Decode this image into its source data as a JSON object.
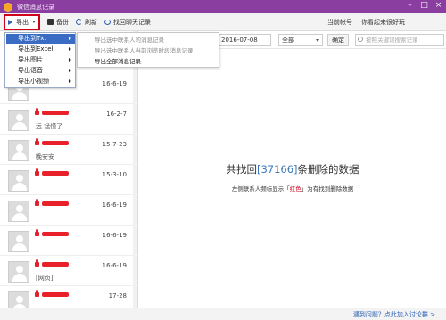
{
  "window": {
    "title": "微信消息记录"
  },
  "toolbar": {
    "export_label": "导出",
    "backup_label": "备份",
    "refresh_label": "刷新",
    "find_label": "找回聊天记录",
    "current_account_label": "当前帐号",
    "greeting": "你看起来很好玩"
  },
  "filters": {
    "date": "2016-07-08",
    "scope": "全部",
    "confirm_label": "确定",
    "search_placeholder": "按照关键词搜索记录"
  },
  "export_menu": {
    "items": [
      {
        "label": "导出到Txt"
      },
      {
        "label": "导出到Excel"
      },
      {
        "label": "导出图片"
      },
      {
        "label": "导出语音"
      },
      {
        "label": "导出小视频"
      }
    ]
  },
  "export_submenu": {
    "items": [
      {
        "label": "导出选中联系人的消息记录"
      },
      {
        "label": "导出选中联系人当前浏览时段消息记录"
      },
      {
        "label": "导出全部消息记录"
      }
    ]
  },
  "chats": [
    {
      "date": "16-6-19",
      "preview": ""
    },
    {
      "date": "16-2-7",
      "preview": "远 锰懂了"
    },
    {
      "date": "15-7-23",
      "preview": "晚安安"
    },
    {
      "date": "15-3-10",
      "preview": ""
    },
    {
      "date": "16-6-19",
      "preview": ""
    },
    {
      "date": "16-6-19",
      "preview": ""
    },
    {
      "date": "16-6-19",
      "preview": "[网页]"
    },
    {
      "date": "17-28",
      "preview": ""
    }
  ],
  "main": {
    "result_prefix": "共找回",
    "deleted_count": "[37166]",
    "result_suffix": "条删除的数据",
    "hint_prefix": "左侧联系人频标显示「",
    "hint_red_word": "红色",
    "hint_suffix": "」为有找到删除数据"
  },
  "status": {
    "help_link": "遇到问题？点此加入讨论群 >"
  },
  "colors": {
    "titlebar": "#8a3ea0",
    "accent": "#3b6cc4",
    "highlight_red": "#d0021b",
    "count_blue": "#3e7ab8"
  }
}
